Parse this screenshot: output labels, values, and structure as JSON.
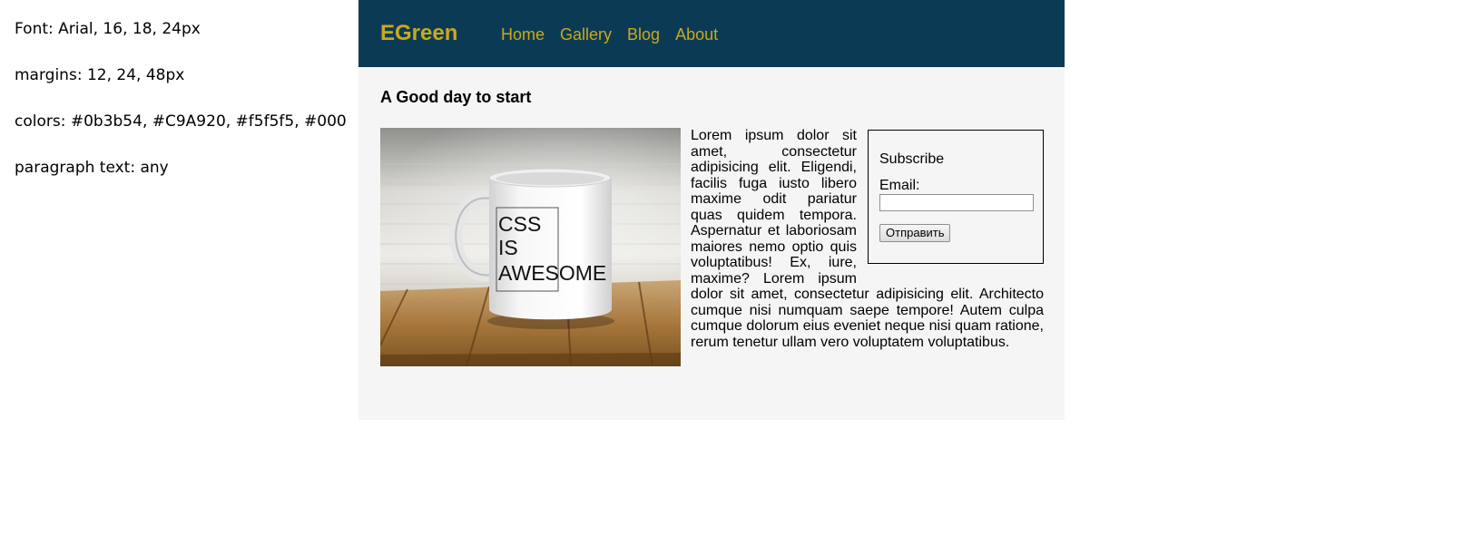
{
  "notes": {
    "font": "Font: Arial,  16, 18, 24px",
    "margins": "margins: 12, 24, 48px",
    "colors": "colors: #0b3b54, #C9A920, #f5f5f5, #000",
    "paragraph": "paragraph text: any"
  },
  "header": {
    "logo": "EGreen",
    "nav": [
      "Home",
      "Gallery",
      "Blog",
      "About"
    ]
  },
  "content": {
    "title": "A Good day to start",
    "image": {
      "icon": "mug-photo",
      "mug_text": [
        "CSS",
        "IS",
        "AWESOME"
      ]
    },
    "paragraph": "Lorem ipsum dolor sit amet, consectetur adipisicing elit. Eligendi, facilis fuga iusto libero maxime odit pariatur quas quidem tempora. Aspernatur et laboriosam maiores nemo optio quis voluptatibus! Ex, iure, maxime? Lorem ipsum dolor sit amet, consectetur adipisicing elit. Architecto cumque nisi numquam saepe tempore! Autem culpa cumque dolorum eius eveniet neque nisi quam ratione, rerum tenetur ullam vero voluptatem voluptatibus."
  },
  "subscribe": {
    "title": "Subscribe",
    "email_label": "Email:",
    "email_value": "",
    "button_label": "Отправить"
  },
  "colors": {
    "primary": "#0b3b54",
    "accent": "#C9A920",
    "background": "#f5f5f5",
    "text": "#000"
  }
}
